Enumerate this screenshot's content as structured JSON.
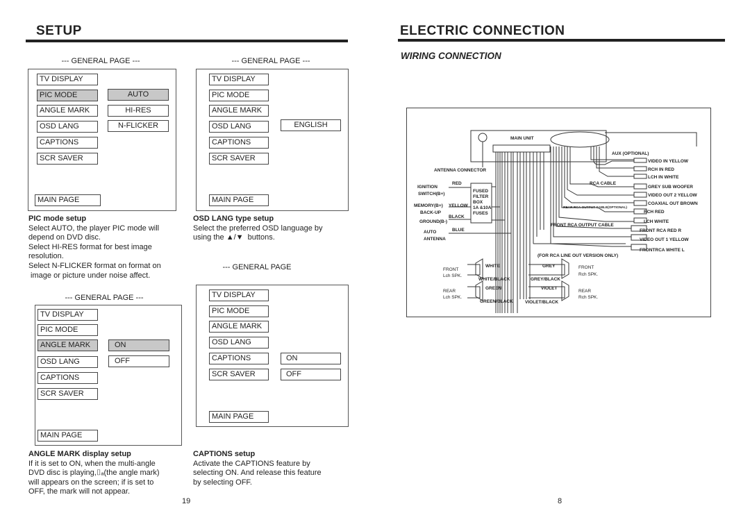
{
  "left_page": {
    "title": "SETUP",
    "page_number": "19",
    "menus": [
      {
        "heading": "--- GENERAL PAGE ---",
        "items": [
          "TV DISPLAY",
          "PIC MODE",
          "ANGLE MARK",
          "OSD LANG",
          "CAPTIONS",
          "SCR SAVER"
        ],
        "selected_item": "PIC MODE",
        "options": [
          "AUTO",
          "HI-RES",
          "N-FLICKER"
        ],
        "selected_option": "AUTO",
        "main_page": "MAIN PAGE"
      },
      {
        "heading": "--- GENERAL PAGE ---",
        "items": [
          "TV DISPLAY",
          "PIC MODE",
          "ANGLE MARK",
          "OSD LANG",
          "CAPTIONS",
          "SCR SAVER"
        ],
        "options": [
          "ENGLISH"
        ],
        "main_page": "MAIN PAGE"
      },
      {
        "heading": "--- GENERAL PAGE ---",
        "items": [
          "TV DISPLAY",
          "PIC MODE",
          "ANGLE MARK",
          "OSD LANG",
          "CAPTIONS",
          "SCR SAVER"
        ],
        "selected_item": "ANGLE MARK",
        "options": [
          "ON",
          "OFF"
        ],
        "selected_option": "ON",
        "main_page": "MAIN PAGE"
      },
      {
        "heading": "--- GENERAL PAGE",
        "items": [
          "TV DISPLAY",
          "PIC MODE",
          "ANGLE MARK",
          "OSD LANG",
          "CAPTIONS",
          "SCR SAVER"
        ],
        "options": [
          "ON",
          "OFF"
        ],
        "main_page": "MAIN PAGE"
      }
    ],
    "descriptions": {
      "pic_mode": {
        "title": "PIC mode setup",
        "lines": [
          "Select AUTO, the player PIC mode will",
          "depend on DVD disc.",
          "Select HI-RES format for best image",
          "resolution.",
          "Select N-FLICKER format on format on",
          " image or picture under noise affect."
        ]
      },
      "osd_lang": {
        "title": "OSD LANG type setup",
        "lines": [
          "Select the preferred OSD language by",
          "using the ▲/▼  buttons."
        ]
      },
      "angle_mark": {
        "title": "ANGLE MARK display setup",
        "lines": [
          "If it is set to ON, when the multi-angle",
          "DVD disc is playing,⌷ₐ(the angle mark)",
          "will appears on the screen; if is set to",
          "OFF, the mark will not appear."
        ]
      },
      "captions": {
        "title": "CAPTIONS setup",
        "lines": [
          "Activate the CAPTIONS feature by",
          "selecting ON.  And release this feature",
          "by selecting OFF."
        ]
      }
    }
  },
  "right_page": {
    "title": "ELECTRIC CONNECTION",
    "subtitle": "WIRING CONNECTION",
    "page_number": "8",
    "diagram": {
      "main_unit": "MAIN UNIT",
      "antenna_connector": "ANTENNA CONNECTOR",
      "fuse_box": [
        "FUSED",
        "FILTER",
        "BOX",
        "1A &10A",
        "FUSES"
      ],
      "left_labels": [
        {
          "label": [
            "IGNITION",
            "SWITCH(B+)"
          ],
          "wire": "RED"
        },
        {
          "label": [
            "MEMORY(B+)",
            "BACK-UP"
          ],
          "wire": "YELLOW"
        },
        {
          "label": [
            "GROUND(B-)"
          ],
          "wire": "BLACK"
        },
        {
          "label": [
            "AUTO",
            "ANTENNA"
          ],
          "wire": "BLUE"
        }
      ],
      "aux": "AUX (OPTIONAL)",
      "rca_cable": "RCA CABLE",
      "rear_rca": "REAR RCA OUTPUT CABLE(OPTIONAL)",
      "front_rca": "FRONT RCA OUTPUT CABLE",
      "line_out_note": "(FOR RCA LINE OUT VERSION ONLY)",
      "connectors": [
        "VIDEO  IN  YELLOW",
        "RCH IN RED",
        "LCH IN WHITE",
        "GREY SUB WOOFER",
        "VIDEO OUT 2 YELLOW",
        "COAXIAL OUT BROWN",
        "RCH RED",
        "LCH WHITE",
        "FRONT RCA   RED R",
        "VIDEO OUT 1 YELLOW",
        "FRONTRCA   WHITE L"
      ],
      "speakers": {
        "front_left": {
          "label": [
            "FRONT",
            "Lch SPK."
          ],
          "pos": "WHITE",
          "neg": "WHITE/BLACK"
        },
        "rear_left": {
          "label": [
            "REAR",
            "Lch SPK."
          ],
          "pos": "GREEN",
          "neg": "GREEN/BLACK"
        },
        "front_right": {
          "label": [
            "FRONT",
            "Rch SPK."
          ],
          "pos": "GREY",
          "neg": "GREY/BLACK"
        },
        "rear_right": {
          "label": [
            "REAR",
            "Rch SPK."
          ],
          "pos": "VIOLET",
          "neg": "VIOLET/BLACK"
        }
      }
    }
  }
}
